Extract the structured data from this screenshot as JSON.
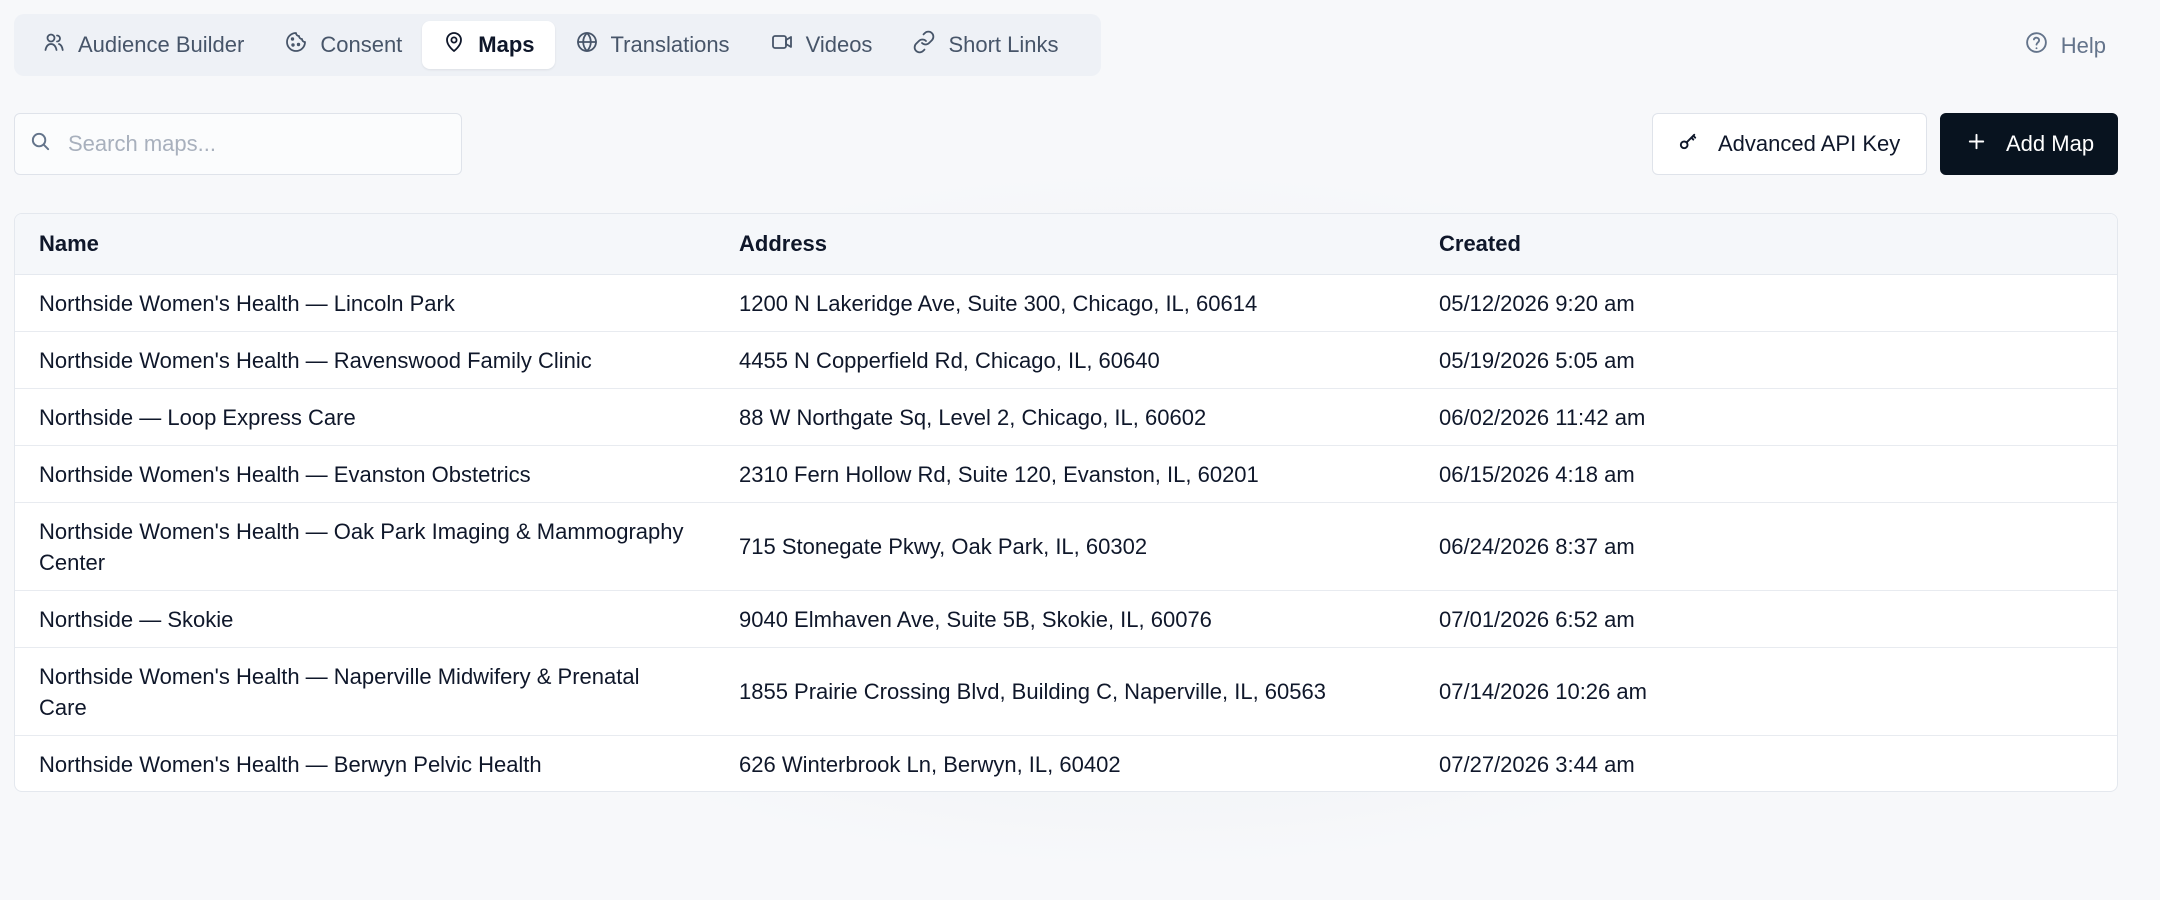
{
  "tabs": [
    {
      "label": "Audience Builder",
      "icon": "users-icon"
    },
    {
      "label": "Consent",
      "icon": "cookie-icon"
    },
    {
      "label": "Maps",
      "icon": "map-pin-icon",
      "active": true
    },
    {
      "label": "Translations",
      "icon": "globe-icon"
    },
    {
      "label": "Videos",
      "icon": "video-camera-icon"
    },
    {
      "label": "Short Links",
      "icon": "link-icon"
    }
  ],
  "help": {
    "label": "Help",
    "icon": "help-circle-icon"
  },
  "search": {
    "placeholder": "Search maps...",
    "value": ""
  },
  "actions": {
    "advanced_api_key": "Advanced API Key",
    "add_map": "Add Map"
  },
  "table": {
    "headers": [
      "Name",
      "Address",
      "Created"
    ],
    "rows": [
      {
        "name": "Northside Women's Health — Lincoln Park",
        "address": "1200 N Lakeridge Ave, Suite 300, Chicago, IL, 60614",
        "created": "05/12/2026 9:20 am"
      },
      {
        "name": "Northside Women's Health — Ravenswood Family Clinic",
        "address": "4455 N Copperfield Rd, Chicago, IL, 60640",
        "created": "05/19/2026 5:05 am"
      },
      {
        "name": "Northside — Loop Express Care",
        "address": "88 W Northgate Sq, Level 2, Chicago, IL, 60602",
        "created": "06/02/2026 11:42 am"
      },
      {
        "name": "Northside Women's Health — Evanston Obstetrics",
        "address": "2310 Fern Hollow Rd, Suite 120, Evanston, IL, 60201",
        "created": "06/15/2026 4:18 am"
      },
      {
        "name": "Northside Women's Health — Oak Park Imaging & Mammography Center",
        "address": "715 Stonegate Pkwy, Oak Park, IL, 60302",
        "created": "06/24/2026 8:37 am"
      },
      {
        "name": "Northside — Skokie",
        "address": "9040 Elmhaven Ave, Suite 5B, Skokie, IL, 60076",
        "created": "07/01/2026 6:52 am"
      },
      {
        "name": "Northside Women's Health — Naperville Midwifery & Prenatal Care",
        "address": "1855 Prairie Crossing Blvd, Building C, Naperville, IL, 60563",
        "created": "07/14/2026 10:26 am"
      },
      {
        "name": "Northside Women's Health — Berwyn Pelvic Health",
        "address": "626 Winterbrook Ln, Berwyn, IL, 60402",
        "created": "07/27/2026 3:44 am"
      }
    ]
  },
  "colors": {
    "primary_button": "#08131f",
    "tab_bar": "#eef1f6",
    "table_header": "#f5f7fa",
    "muted_text": "#64748b"
  }
}
